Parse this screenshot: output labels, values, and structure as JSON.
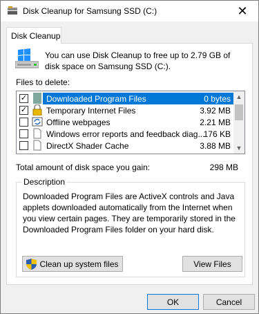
{
  "window": {
    "title": "Disk Cleanup for Samsung SSD (C:)",
    "close_glyph": "✕"
  },
  "tab": {
    "label": "Disk Cleanup"
  },
  "intro": {
    "text": "You can use Disk Cleanup to free up to 2.79 GB of disk space on Samsung SSD (C:)."
  },
  "files": {
    "label": "Files to delete:",
    "items": [
      {
        "name": "Downloaded Program Files",
        "size": "0 bytes",
        "checked": true,
        "selected": true,
        "icon": "folder-icon"
      },
      {
        "name": "Temporary Internet Files",
        "size": "3.92 MB",
        "checked": true,
        "selected": false,
        "icon": "lock-icon"
      },
      {
        "name": "Offline webpages",
        "size": "2.21 MB",
        "checked": false,
        "selected": false,
        "icon": "sync-icon"
      },
      {
        "name": "Windows error reports and feedback diag...",
        "size": "176 KB",
        "checked": false,
        "selected": false,
        "icon": "file-icon"
      },
      {
        "name": "DirectX Shader Cache",
        "size": "3.88 MB",
        "checked": false,
        "selected": false,
        "icon": "file-icon"
      }
    ]
  },
  "total": {
    "label": "Total amount of disk space you gain:",
    "value": "298 MB"
  },
  "description": {
    "legend": "Description",
    "text": "Downloaded Program Files are ActiveX controls and Java applets downloaded automatically from the Internet when you view certain pages. They are temporarily stored in the Downloaded Program Files folder on your hard disk."
  },
  "buttons": {
    "cleanup_system": "Clean up system files",
    "view_files": "View Files",
    "ok": "OK",
    "cancel": "Cancel"
  },
  "colors": {
    "selection": "#0078d7",
    "window_bg": "#f0f0f0"
  }
}
